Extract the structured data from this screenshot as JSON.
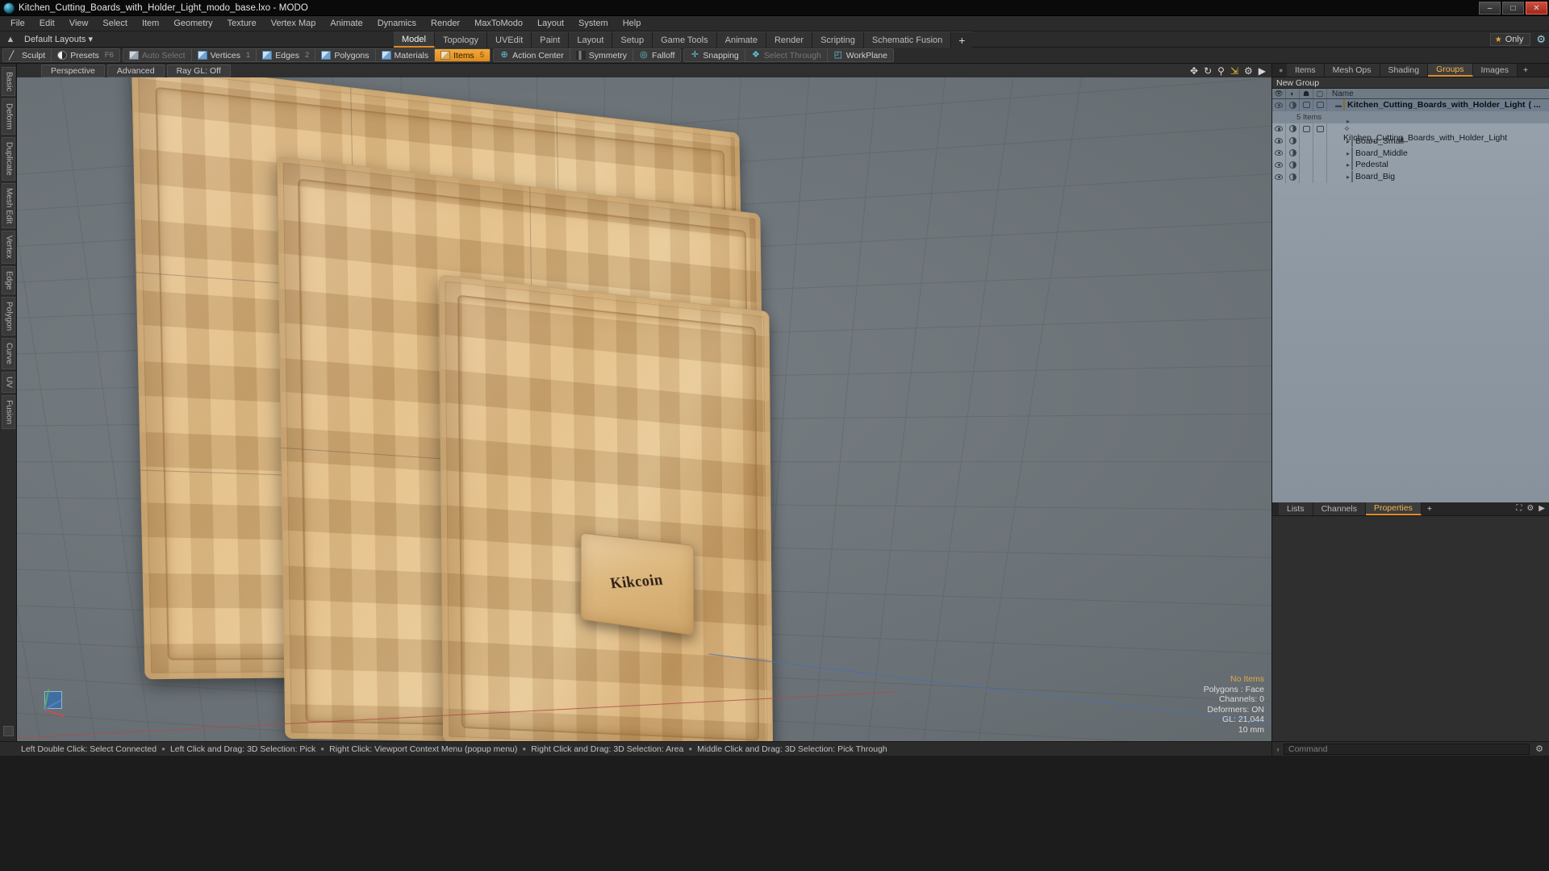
{
  "window": {
    "title": "Kitchen_Cutting_Boards_with_Holder_Light_modo_base.lxo - MODO",
    "app_icon": "modo-logo-icon",
    "minimize": "–",
    "maximize": "□",
    "close": "✕"
  },
  "menubar": {
    "items": [
      "File",
      "Edit",
      "View",
      "Select",
      "Item",
      "Geometry",
      "Texture",
      "Vertex Map",
      "Animate",
      "Dynamics",
      "Render",
      "MaxToModo",
      "Layout",
      "System",
      "Help"
    ]
  },
  "layoutbar": {
    "home_icon": "home-icon",
    "layout_selector": "Default Layouts ▾",
    "tabs": [
      {
        "label": "Model",
        "active": true
      },
      {
        "label": "Topology",
        "active": false
      },
      {
        "label": "UVEdit",
        "active": false
      },
      {
        "label": "Paint",
        "active": false
      },
      {
        "label": "Layout",
        "active": false
      },
      {
        "label": "Setup",
        "active": false
      },
      {
        "label": "Game Tools",
        "active": false
      },
      {
        "label": "Animate",
        "active": false
      },
      {
        "label": "Render",
        "active": false
      },
      {
        "label": "Scripting",
        "active": false
      },
      {
        "label": "Schematic Fusion",
        "active": false
      }
    ],
    "add_tab": "+",
    "only_label": "Only",
    "star_icon": "star-icon",
    "gear_icon": "gear-icon"
  },
  "modebar": {
    "groups": [
      {
        "buttons": [
          {
            "label": "Sculpt",
            "key": "",
            "icon": "sculpt-icon",
            "state": "normal"
          },
          {
            "label": "Presets",
            "key": "F6",
            "icon": "sphere-icon",
            "state": "normal"
          }
        ]
      },
      {
        "buttons": [
          {
            "label": "Auto Select",
            "key": "",
            "icon": "cube-grey-icon",
            "state": "dim"
          },
          {
            "label": "Vertices",
            "key": "1",
            "icon": "cube-blue-icon",
            "state": "normal"
          },
          {
            "label": "Edges",
            "key": "2",
            "icon": "cube-blue-icon",
            "state": "normal"
          },
          {
            "label": "Polygons",
            "key": "",
            "icon": "cube-blue-icon",
            "state": "normal"
          },
          {
            "label": "Materials",
            "key": "",
            "icon": "cube-blue-icon",
            "state": "normal"
          },
          {
            "label": "Items",
            "key": "5",
            "icon": "cube-orange-icon",
            "state": "active"
          }
        ]
      },
      {
        "buttons": [
          {
            "label": "Action Center",
            "key": "",
            "icon": "action-center-icon",
            "state": "normal"
          },
          {
            "label": "Symmetry",
            "key": "",
            "icon": "symmetry-icon",
            "state": "normal"
          },
          {
            "label": "Falloff",
            "key": "",
            "icon": "falloff-icon",
            "state": "normal"
          }
        ]
      },
      {
        "buttons": [
          {
            "label": "Snapping",
            "key": "",
            "icon": "snapping-icon",
            "state": "normal"
          },
          {
            "label": "Select Through",
            "key": "",
            "icon": "select-through-icon",
            "state": "dim"
          },
          {
            "label": "WorkPlane",
            "key": "",
            "icon": "workplane-icon",
            "state": "normal"
          }
        ]
      }
    ]
  },
  "left_strip": {
    "tabs": [
      "Basic",
      "Deform",
      "Duplicate",
      "Mesh Edit",
      "Vertex",
      "Edge",
      "Polygon",
      "Curve",
      "UV",
      "Fusion"
    ]
  },
  "viewport": {
    "buttons": [
      "Perspective",
      "Advanced",
      "Ray GL: Off"
    ],
    "tools": [
      {
        "icon": "pan-icon"
      },
      {
        "icon": "rotate-icon"
      },
      {
        "icon": "zoom-icon"
      },
      {
        "icon": "fit-icon"
      },
      {
        "icon": "gear-icon"
      },
      {
        "icon": "chevron-right-icon"
      }
    ],
    "stats": {
      "selection": "No Items",
      "polygons": "Polygons : Face",
      "channels": "Channels: 0",
      "deformers": "Deformers: ON",
      "gl": "GL: 21,044",
      "grid": "10 mm"
    },
    "model": {
      "brand_logo": "Kikcoin",
      "boards": [
        "Board_Big",
        "Board_Middle",
        "Board_Small"
      ],
      "pedestal": "Pedestal"
    }
  },
  "right_dock": {
    "tabs": [
      {
        "label": "Items",
        "active": false
      },
      {
        "label": "Mesh Ops",
        "active": false
      },
      {
        "label": "Shading",
        "active": false
      },
      {
        "label": "Groups",
        "active": true
      },
      {
        "label": "Images",
        "active": false
      }
    ],
    "add_tab": "+",
    "group_name": "New Group",
    "columns": [
      "eye-icon",
      "render-icon",
      "lock-icon",
      "shade-icon",
      "Name"
    ],
    "tree": [
      {
        "label": "Kitchen_Cutting_Boards_with_Holder_Light",
        "suffix": "( ...",
        "selected": true,
        "indent": 0,
        "icon": "group-icon",
        "subtext": "5 Items"
      },
      {
        "label": "Kitchen_Cutting_Boards_with_Holder_Light",
        "suffix": "",
        "selected": false,
        "indent": 1,
        "icon": "mesh-icon",
        "subtext": ""
      },
      {
        "label": "Board_Small",
        "suffix": "",
        "selected": false,
        "indent": 1,
        "icon": "item-icon",
        "subtext": ""
      },
      {
        "label": "Board_Middle",
        "suffix": "",
        "selected": false,
        "indent": 1,
        "icon": "item-icon",
        "subtext": ""
      },
      {
        "label": "Pedestal",
        "suffix": "",
        "selected": false,
        "indent": 1,
        "icon": "item-icon",
        "subtext": ""
      },
      {
        "label": "Board_Big",
        "suffix": "",
        "selected": false,
        "indent": 1,
        "icon": "item-icon",
        "subtext": ""
      }
    ]
  },
  "properties_panel": {
    "tabs": [
      {
        "label": "Properties",
        "active": true
      },
      {
        "label": "Channels",
        "active": false
      },
      {
        "label": "Lists",
        "active": false
      }
    ],
    "add_tab": "+",
    "corner_icons": [
      "expand-icon",
      "gear-icon",
      "chevron-right-icon"
    ]
  },
  "statusbar": {
    "hints": [
      "Left Double Click: Select Connected",
      "Left Click and Drag: 3D Selection: Pick",
      "Right Click: Viewport Context Menu (popup menu)",
      "Right Click and Drag: 3D Selection: Area",
      "Middle Click and Drag: 3D Selection: Pick Through"
    ],
    "command_placeholder": "Command",
    "command_value": "",
    "command_arrow": "›",
    "command_gear": "gear-icon"
  },
  "colors": {
    "accent_orange": "#e08b28",
    "panel_bg": "#2b2b2b",
    "list_bg": "#97a2ac",
    "viewport_bg": "#6d7479"
  }
}
